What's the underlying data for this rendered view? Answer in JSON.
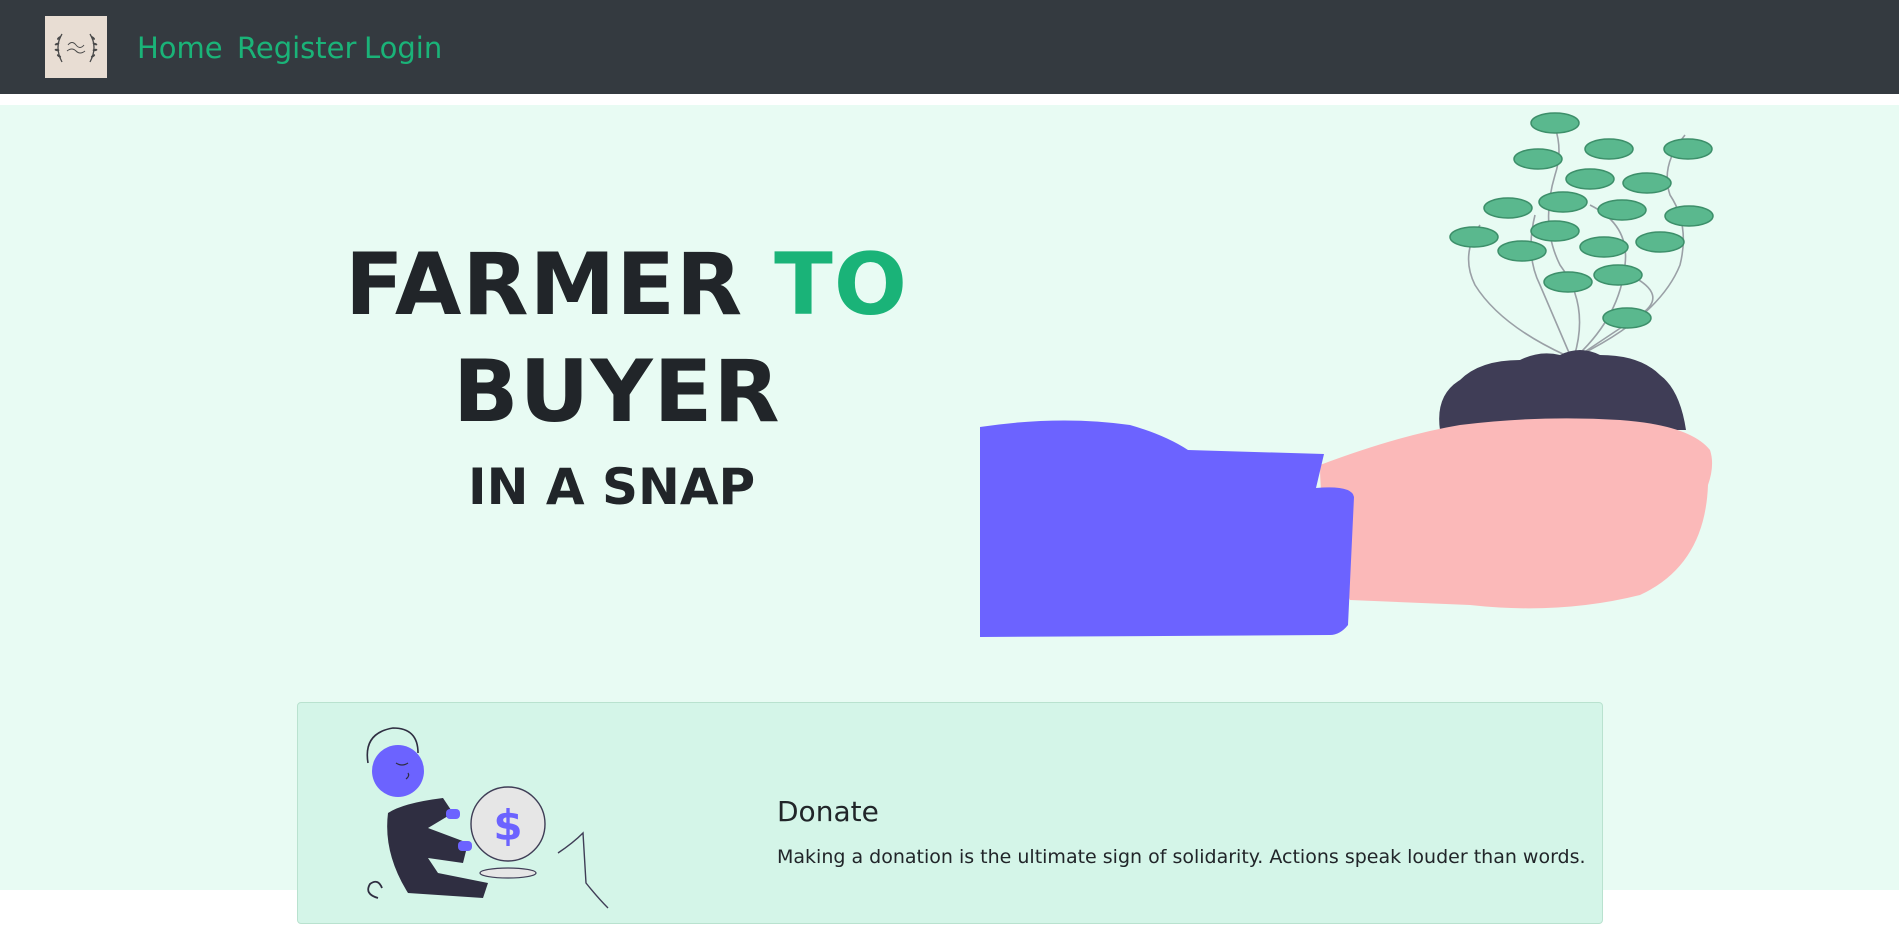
{
  "navbar": {
    "logo_icon": "wreath-logo-icon",
    "links": [
      {
        "label": "Home"
      },
      {
        "label": "Register"
      },
      {
        "label": "Login"
      }
    ]
  },
  "hero": {
    "line1_main": "FARMER",
    "line1_accent": "TO",
    "line2": "BUYER",
    "line3": "IN A SNAP",
    "illustration_icon": "hand-holding-plant-icon"
  },
  "donate_card": {
    "title": "Donate",
    "text": "Making a donation is the ultimate sign of solidarity. Actions speak louder than words.",
    "illustration_icon": "person-holding-coin-icon",
    "coin_symbol": "$"
  },
  "colors": {
    "navbar_bg": "#343a40",
    "accent": "#1ab378",
    "hero_bg": "#e8fbf3",
    "card_bg": "#d4f5e8",
    "sleeve": "#6c63ff",
    "skin": "#fbb9b9",
    "soil": "#3f3d56",
    "leaf": "#5ab88e"
  }
}
